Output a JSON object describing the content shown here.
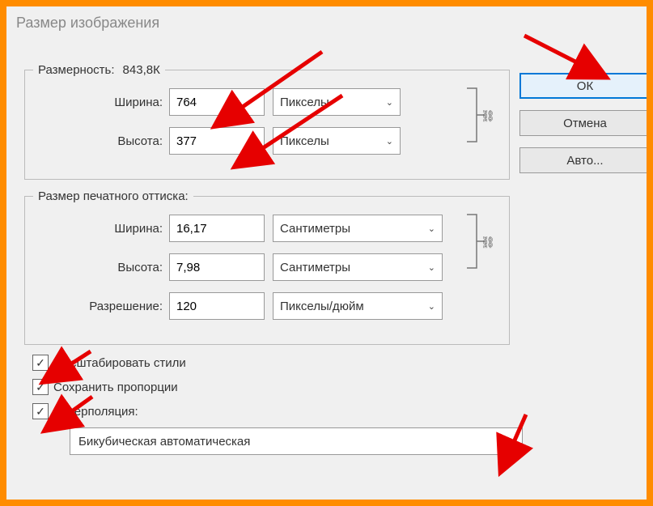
{
  "window_title": "Размер изображения",
  "pixel_dimensions": {
    "legend_prefix": "Размерность:",
    "size_text": "843,8К",
    "width_label": "Ширина:",
    "width_value": "764",
    "height_label": "Высота:",
    "height_value": "377",
    "unit": "Пикселы"
  },
  "print_dimensions": {
    "legend": "Размер печатного оттиска:",
    "width_label": "Ширина:",
    "width_value": "16,17",
    "height_label": "Высота:",
    "height_value": "7,98",
    "unit": "Сантиметры",
    "resolution_label": "Разрешение:",
    "resolution_value": "120",
    "resolution_unit": "Пикселы/дюйм"
  },
  "checkboxes": {
    "scale_styles": "Масштабировать стили",
    "constrain": "Сохранить пропорции",
    "interpolation_label": "Интерполяция:"
  },
  "interpolation_method": "Бикубическая автоматическая",
  "buttons": {
    "ok": "ОК",
    "cancel": "Отмена",
    "auto": "Авто..."
  },
  "icons": {
    "chevron": "⌄",
    "check": "✓",
    "link": "⛓"
  },
  "colors": {
    "annotation": "#e60000",
    "frame": "#ff8c00",
    "primary_border": "#0078d7"
  }
}
